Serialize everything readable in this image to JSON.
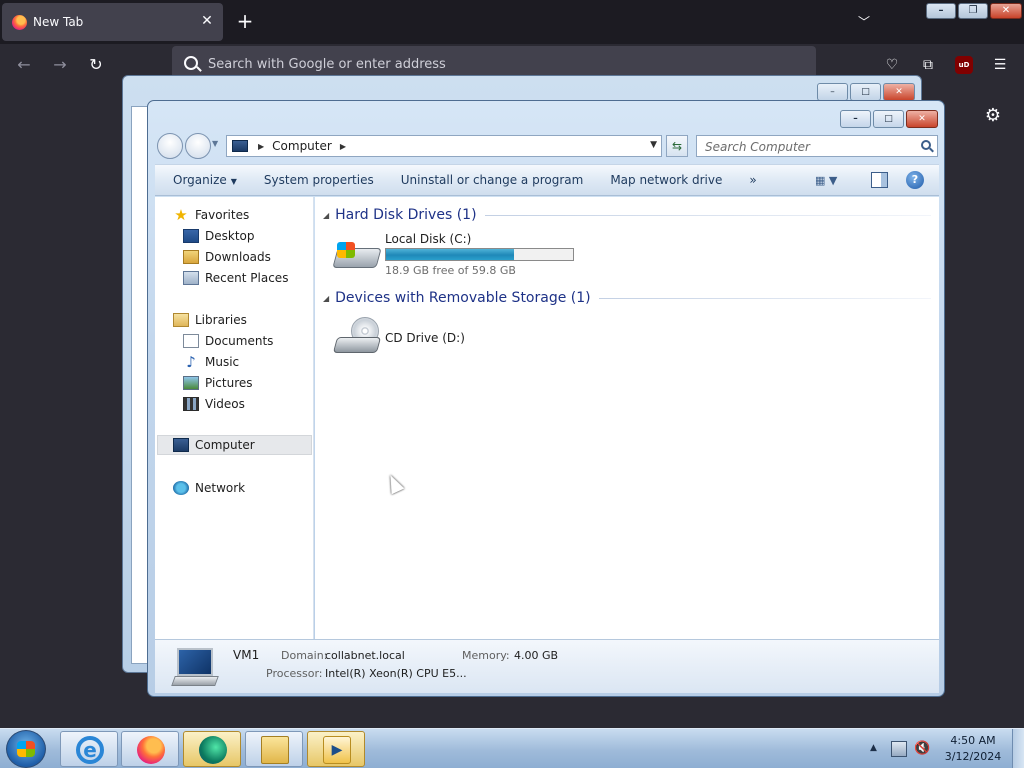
{
  "browser": {
    "tab_title": "New Tab",
    "tab_close_glyph": "✕",
    "new_tab_glyph": "+",
    "list_tabs_glyph": "﹀",
    "url_placeholder": "Search with Google or enter address",
    "icons": [
      "back-arrow-icon",
      "forward-arrow-icon",
      "reload-icon",
      "search-icon",
      "pocket-icon",
      "extensions-icon",
      "ublock-origin-icon",
      "menu-icon",
      "settings-gear-icon"
    ],
    "ublock_label": "uD"
  },
  "explorer": {
    "breadcrumb": "Computer",
    "search_placeholder": "Search Computer",
    "toolbar": {
      "organize": "Organize",
      "system_properties": "System properties",
      "uninstall": "Uninstall or change a program",
      "map_drive": "Map network drive",
      "more": "»"
    },
    "nav": {
      "favorites": "Favorites",
      "desktop": "Desktop",
      "downloads": "Downloads",
      "recent_places": "Recent Places",
      "libraries": "Libraries",
      "documents": "Documents",
      "music": "Music",
      "pictures": "Pictures",
      "videos": "Videos",
      "computer": "Computer",
      "network": "Network"
    },
    "groups": {
      "hdd": "Hard Disk Drives (1)",
      "removable": "Devices with Removable Storage (1)"
    },
    "drives": {
      "c_name": "Local Disk (C:)",
      "c_free": "18.9 GB free of 59.8 GB",
      "c_used_fraction": 0.684,
      "d_name": "CD Drive (D:)"
    },
    "details": {
      "name": "VM1",
      "domain_label": "Domain:",
      "domain": "collabnet.local",
      "memory_label": "Memory:",
      "memory": "4.00 GB",
      "processor_label": "Processor:",
      "processor": "Intel(R) Xeon(R) CPU E5..."
    }
  },
  "taskbar": {
    "apps": [
      "internet-explorer",
      "firefox",
      "edge",
      "windows-explorer",
      "media-player"
    ],
    "time": "4:50 AM",
    "date": "3/12/2024"
  },
  "colors": {
    "firefox_dark": "#2b2a33",
    "aero_frame": "#c3d7ed",
    "group_title": "#1e3287",
    "disk_bar": "#1f88b8"
  }
}
